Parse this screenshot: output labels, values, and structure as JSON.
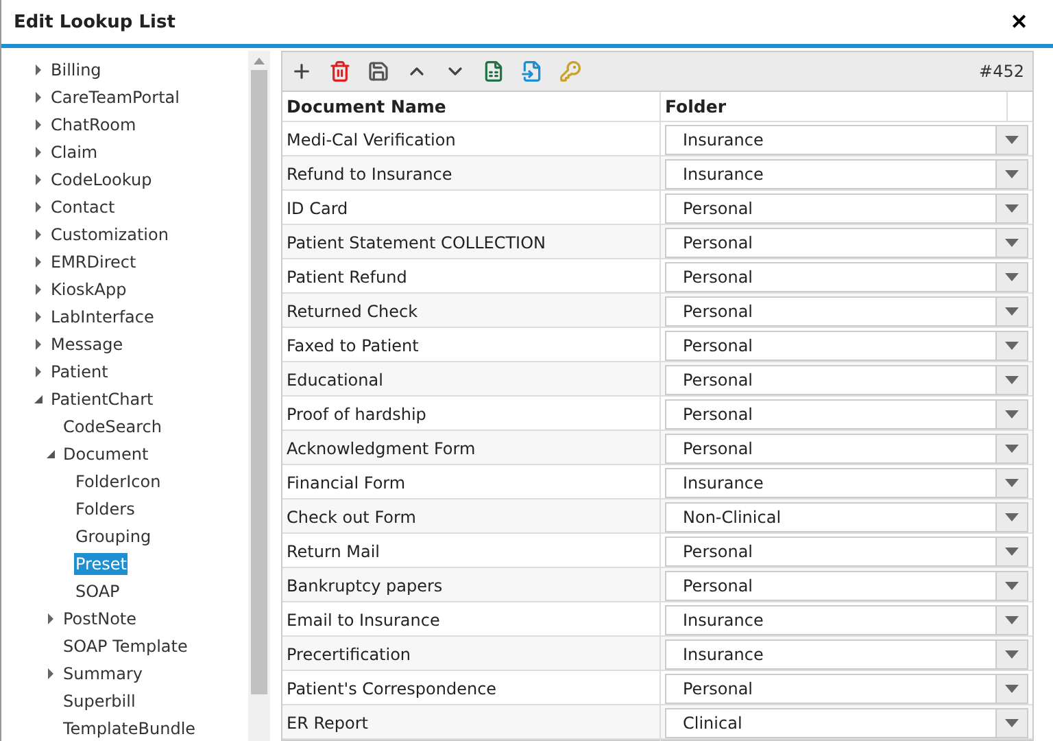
{
  "window": {
    "title": "Edit Lookup List",
    "close": "✕"
  },
  "tree": [
    {
      "label": "Billing",
      "expanded": false,
      "selected": false
    },
    {
      "label": "CareTeamPortal",
      "expanded": false,
      "selected": false
    },
    {
      "label": "ChatRoom",
      "expanded": false,
      "selected": false
    },
    {
      "label": "Claim",
      "expanded": false,
      "selected": false
    },
    {
      "label": "CodeLookup",
      "expanded": false,
      "selected": false
    },
    {
      "label": "Contact",
      "expanded": false,
      "selected": false
    },
    {
      "label": "Customization",
      "expanded": false,
      "selected": false
    },
    {
      "label": "EMRDirect",
      "expanded": false,
      "selected": false
    },
    {
      "label": "KioskApp",
      "expanded": false,
      "selected": false
    },
    {
      "label": "LabInterface",
      "expanded": false,
      "selected": false
    },
    {
      "label": "Message",
      "expanded": false,
      "selected": false
    },
    {
      "label": "Patient",
      "expanded": false,
      "selected": false
    },
    {
      "label": "PatientChart",
      "expanded": true,
      "selected": false,
      "children": [
        {
          "label": "CodeSearch",
          "selected": false
        },
        {
          "label": "Document",
          "expanded": true,
          "selected": false,
          "children": [
            {
              "label": "FolderIcon",
              "selected": false
            },
            {
              "label": "Folders",
              "selected": false
            },
            {
              "label": "Grouping",
              "selected": false
            },
            {
              "label": "Preset",
              "selected": true
            },
            {
              "label": "SOAP",
              "selected": false
            }
          ]
        },
        {
          "label": "PostNote",
          "expanded": false,
          "selected": false
        },
        {
          "label": "SOAP Template",
          "selected": false
        },
        {
          "label": "Summary",
          "expanded": false,
          "selected": false
        },
        {
          "label": "Superbill",
          "selected": false
        },
        {
          "label": "TemplateBundle",
          "selected": false
        }
      ]
    }
  ],
  "toolbar": {
    "record_count": "#452"
  },
  "table": {
    "columns": [
      "Document Name",
      "Folder"
    ],
    "rows": [
      {
        "name": "Medi-Cal Verification",
        "folder": "Insurance"
      },
      {
        "name": "Refund to Insurance",
        "folder": "Insurance"
      },
      {
        "name": "ID Card",
        "folder": "Personal"
      },
      {
        "name": "Patient Statement COLLECTION",
        "folder": "Personal"
      },
      {
        "name": "Patient Refund",
        "folder": "Personal"
      },
      {
        "name": "Returned Check",
        "folder": "Personal"
      },
      {
        "name": "Faxed to Patient",
        "folder": "Personal"
      },
      {
        "name": "Educational",
        "folder": "Personal"
      },
      {
        "name": "Proof of hardship",
        "folder": "Personal"
      },
      {
        "name": "Acknowledgment Form",
        "folder": "Personal"
      },
      {
        "name": "Financial Form",
        "folder": "Insurance"
      },
      {
        "name": "Check out Form",
        "folder": "Non-Clinical"
      },
      {
        "name": "Return Mail",
        "folder": "Personal"
      },
      {
        "name": "Bankruptcy papers",
        "folder": "Personal"
      },
      {
        "name": "Email to Insurance",
        "folder": "Insurance"
      },
      {
        "name": "Precertification",
        "folder": "Insurance"
      },
      {
        "name": "Patient's Correspondence",
        "folder": "Personal"
      },
      {
        "name": "ER Report",
        "folder": "Clinical"
      }
    ]
  }
}
